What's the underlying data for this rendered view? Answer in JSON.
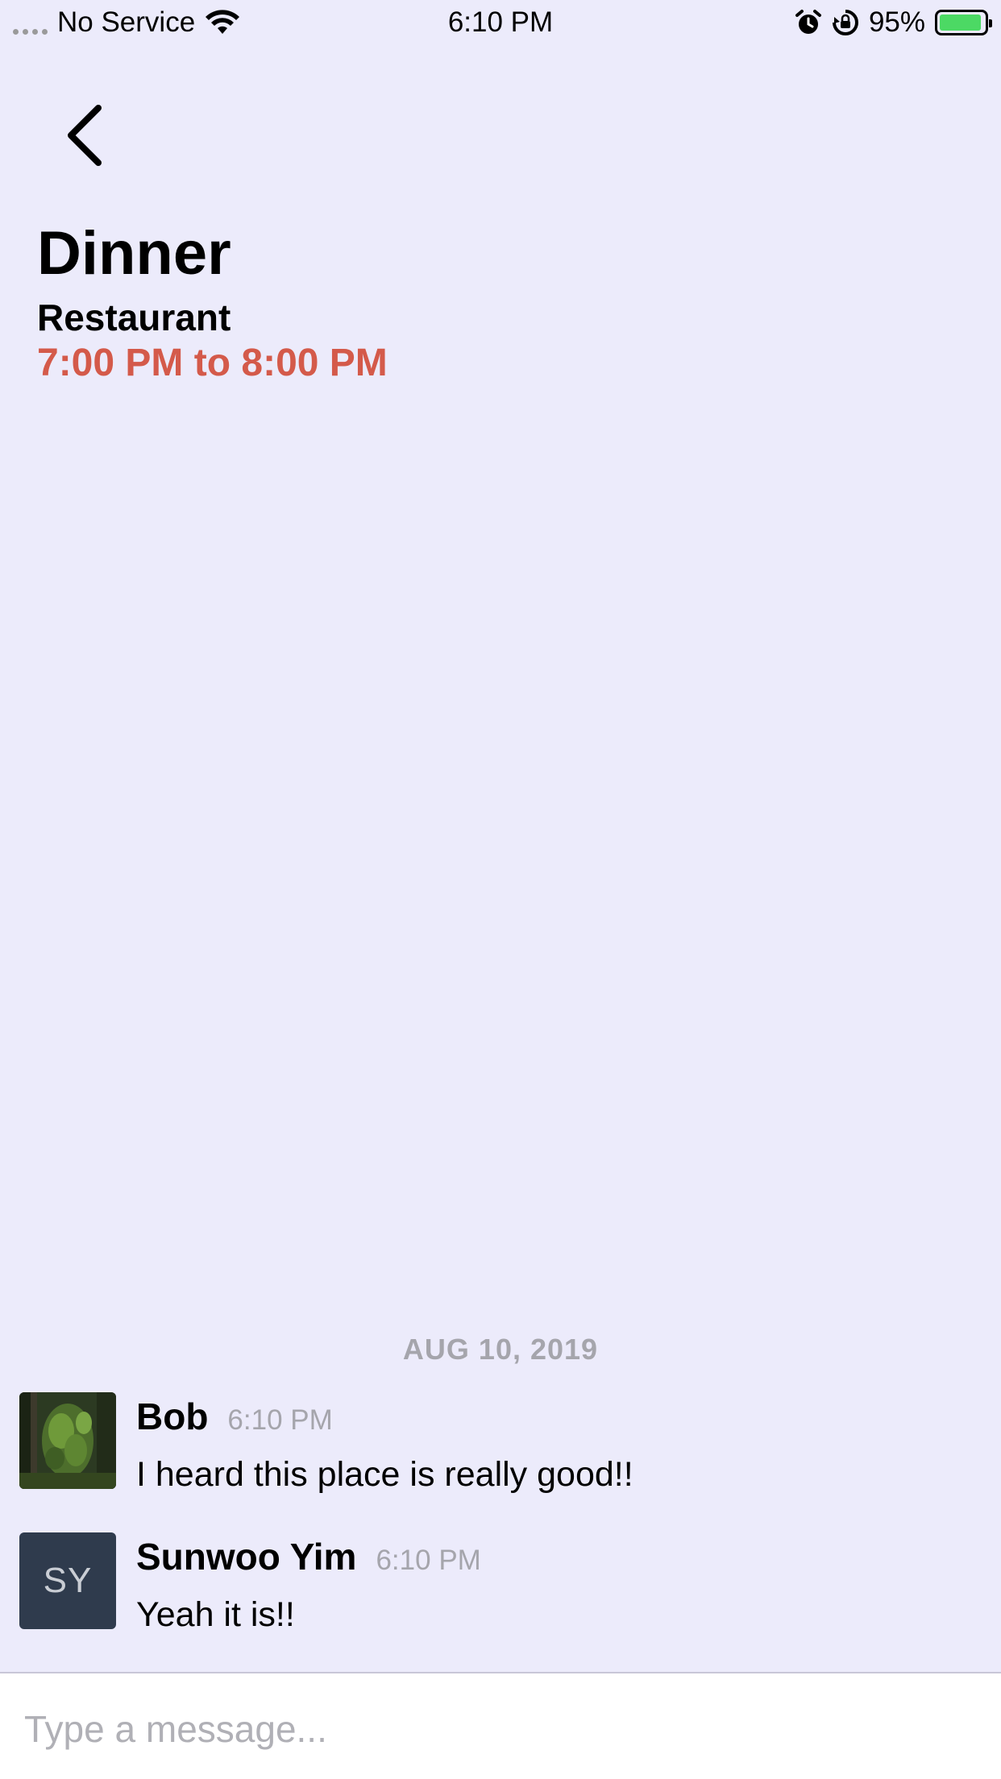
{
  "status_bar": {
    "carrier": "No Service",
    "time": "6:10 PM",
    "battery_percent": "95%",
    "battery_level": 0.95,
    "battery_color": "#4cd964"
  },
  "header": {
    "back_icon": "chevron-left-icon",
    "title": "Dinner",
    "location": "Restaurant",
    "time_range": "7:00 PM to 8:00 PM",
    "time_range_color": "#d45a4a"
  },
  "chat": {
    "date_separator": "AUG 10, 2019",
    "messages": [
      {
        "sender": "Bob",
        "time": "6:10 PM",
        "text": "I heard this place is really good!!",
        "avatar": "forest-photo"
      },
      {
        "sender": "Sunwoo Yim",
        "time": "6:10 PM",
        "text": "Yeah it is!!",
        "avatar_initials": "SY",
        "avatar_color": "#2f3b4d"
      }
    ]
  },
  "composer": {
    "placeholder": "Type a message..."
  }
}
